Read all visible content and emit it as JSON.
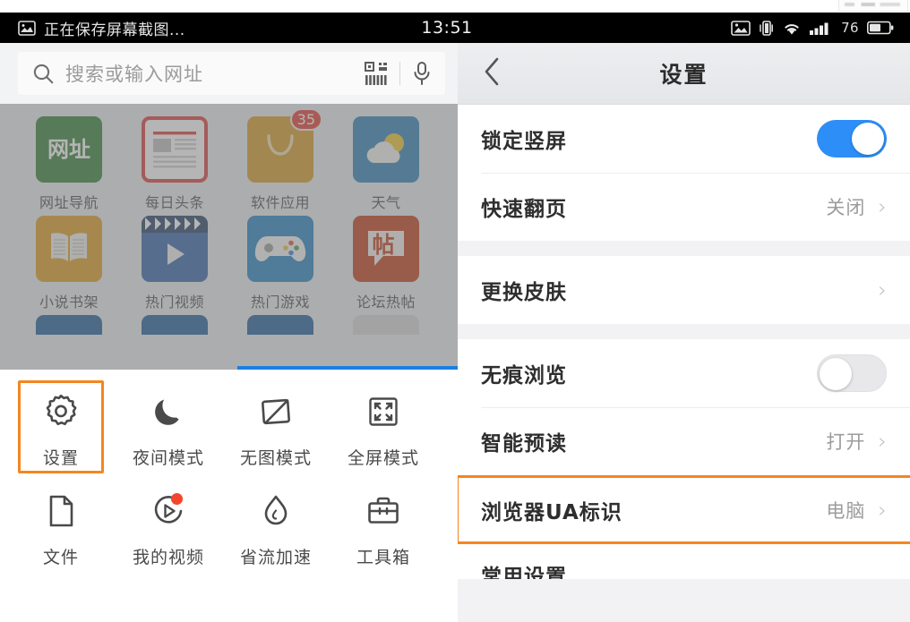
{
  "statusbar": {
    "notification_text": "正在保存屏幕截图...",
    "notification_icon": "image-icon",
    "time": "13:51",
    "battery_percent": "76",
    "icons": [
      "image-icon",
      "vibrate-icon",
      "wifi-icon",
      "signal-icon",
      "battery-icon"
    ]
  },
  "browser": {
    "search": {
      "placeholder": "搜索或输入网址",
      "search_icon": "search-icon",
      "qr_icon": "qrcode-scan-icon",
      "mic_icon": "microphone-icon"
    },
    "shortcuts": [
      {
        "label": "网址导航",
        "tile_text": "网址",
        "color": "#2f7d32",
        "icon": "website-nav-icon"
      },
      {
        "label": "每日头条",
        "tile_text": "",
        "color": "#d93a36",
        "icon": "newspaper-icon"
      },
      {
        "label": "软件应用",
        "tile_text": "",
        "color": "#d89a23",
        "icon": "app-bag-icon",
        "badge": "35"
      },
      {
        "label": "天气",
        "tile_text": "",
        "color": "#2a7fb5",
        "icon": "weather-cloud-sun-icon"
      },
      {
        "label": "小说书架",
        "tile_text": "",
        "color": "#dd9b1e",
        "icon": "open-book-icon"
      },
      {
        "label": "热门视频",
        "tile_text": "",
        "color": "#2f5fa8",
        "icon": "clapperboard-play-icon"
      },
      {
        "label": "热门游戏",
        "tile_text": "",
        "color": "#1f7fc0",
        "icon": "gamepad-icon"
      },
      {
        "label": "论坛热帖",
        "tile_text": "帖",
        "color": "#c13a14",
        "icon": "forum-post-icon"
      }
    ],
    "partial_row_colors": [
      "#1a5a99",
      "#1a5a99",
      "#1a5a99",
      "#d8d8d8"
    ],
    "menu": [
      {
        "label": "设置",
        "icon": "gear-icon",
        "highlighted": true
      },
      {
        "label": "夜间模式",
        "icon": "moon-icon",
        "highlighted": false
      },
      {
        "label": "无图模式",
        "icon": "no-image-icon",
        "highlighted": false
      },
      {
        "label": "全屏模式",
        "icon": "fullscreen-icon",
        "highlighted": false
      },
      {
        "label": "文件",
        "icon": "document-icon",
        "highlighted": false
      },
      {
        "label": "我的视频",
        "icon": "my-video-icon",
        "highlighted": false,
        "dot": true
      },
      {
        "label": "省流加速",
        "icon": "water-drop-icon",
        "highlighted": false
      },
      {
        "label": "工具箱",
        "icon": "toolbox-icon",
        "highlighted": false
      }
    ]
  },
  "settings": {
    "nav": {
      "title": "设置",
      "back_icon": "chevron-left-icon"
    },
    "group1": [
      {
        "label": "锁定竖屏",
        "control": "toggle",
        "on": true
      },
      {
        "label": "快速翻页",
        "control": "value",
        "value": "关闭"
      }
    ],
    "group2": [
      {
        "label": "更换皮肤",
        "control": "chevron",
        "value": ""
      }
    ],
    "group3": [
      {
        "label": "无痕浏览",
        "control": "toggle",
        "on": false
      },
      {
        "label": "智能预读",
        "control": "value",
        "value": "打开"
      }
    ],
    "group4": [
      {
        "label": "浏览器UA标识",
        "control": "value",
        "value": "电脑",
        "highlighted": true
      }
    ],
    "clipped_row_label": "常用设置"
  },
  "colors": {
    "accent_blue": "#2e8ef7",
    "highlight_orange": "#f5861f",
    "progress_blue": "#1b7fe0",
    "badge_red": "#e2382b"
  }
}
